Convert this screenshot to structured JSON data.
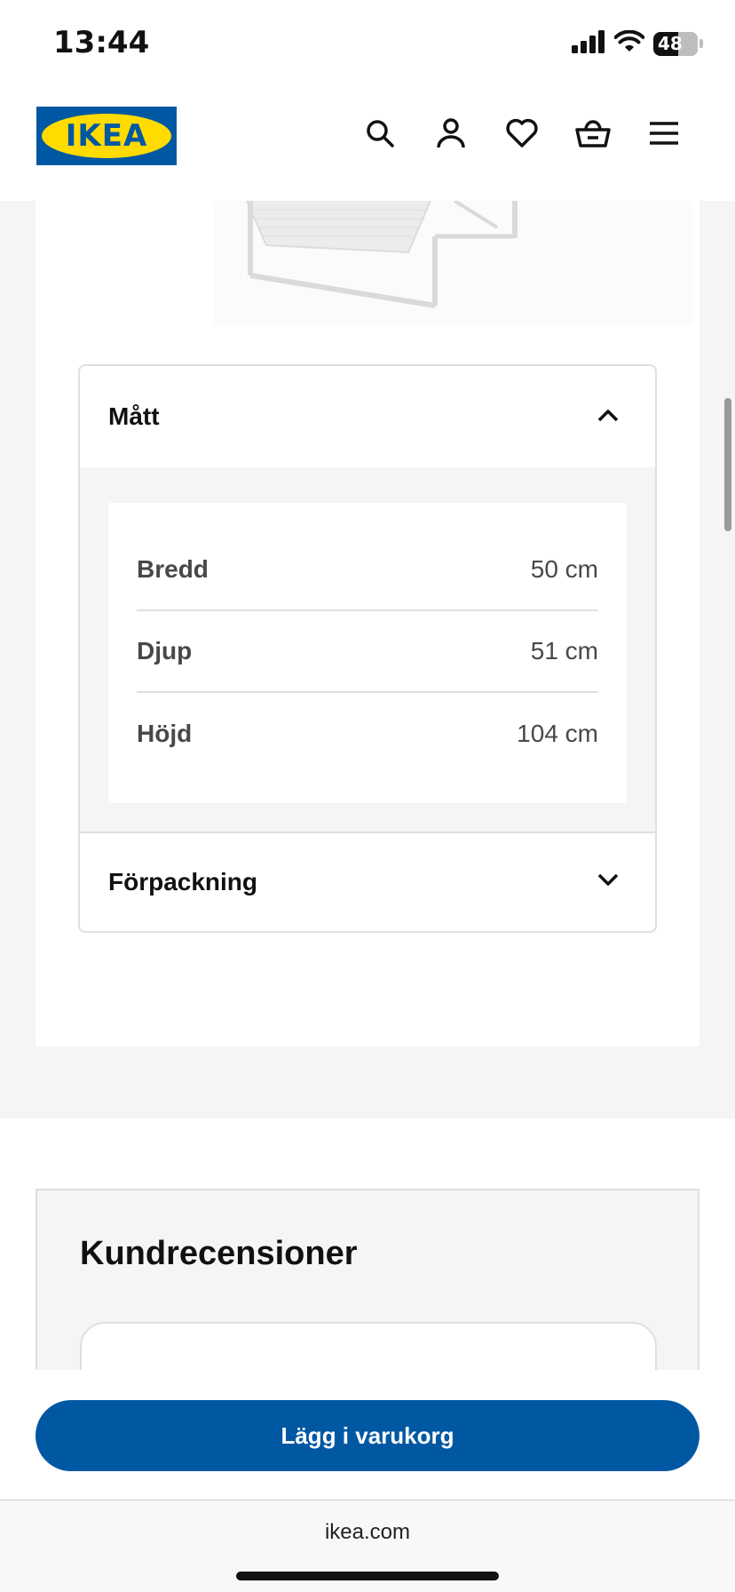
{
  "status_bar": {
    "time": "13:44",
    "battery": "48"
  },
  "header": {
    "logo_text": "IKEA",
    "icons": [
      "search-icon",
      "account-icon",
      "heart-icon",
      "cart-icon",
      "menu-icon"
    ]
  },
  "dimensions_section": {
    "title": "Mått",
    "rows": [
      {
        "label": "Bredd",
        "value": "50 cm"
      },
      {
        "label": "Djup",
        "value": "51 cm"
      },
      {
        "label": "Höjd",
        "value": "104 cm"
      }
    ]
  },
  "packaging_section": {
    "title": "Förpackning"
  },
  "reviews": {
    "title": "Kundrecensioner"
  },
  "cta": {
    "label": "Lägg i varukorg"
  },
  "browser": {
    "url": "ikea.com"
  },
  "colors": {
    "ikea_blue": "#0058a3",
    "ikea_yellow": "#ffdb00"
  }
}
